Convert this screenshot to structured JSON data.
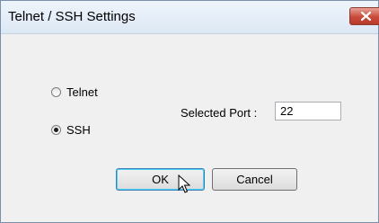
{
  "window": {
    "title": "Telnet / SSH Settings"
  },
  "options": {
    "telnet_label": "Telnet",
    "ssh_label": "SSH",
    "selected": "SSH"
  },
  "port": {
    "label": "Selected Port :",
    "value": "22"
  },
  "buttons": {
    "ok_label": "OK",
    "cancel_label": "Cancel"
  },
  "icons": {
    "close": "close-icon",
    "cursor": "mouse-pointer-icon"
  },
  "colors": {
    "close_button": "#c9493a",
    "default_button_border": "#3c7fb1"
  }
}
